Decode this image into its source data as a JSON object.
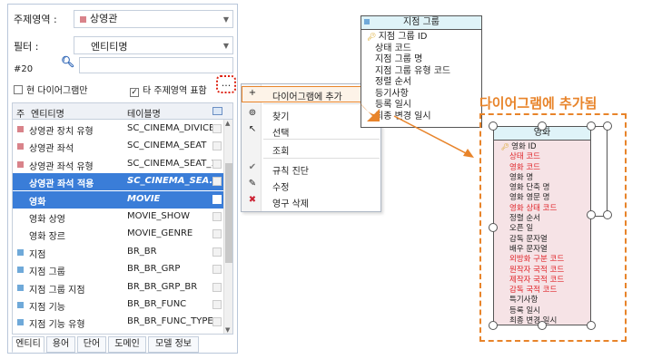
{
  "left_panel": {
    "subject_area": {
      "label": "주제영역 :",
      "value": "상영관",
      "color": "#d9838a"
    },
    "filter": {
      "label": "필터 :",
      "value": "엔티티명"
    },
    "count": "#20",
    "checkbox_current": "현 다이어그램만",
    "checkbox_other": "타 주제영역 표함",
    "dots_button": "...",
    "grid": {
      "headers": [
        "주",
        "엔티티명",
        "테이블명"
      ],
      "rows": [
        {
          "marker": "■",
          "marker_color": "#d9838a",
          "name": "상영관 장치 유형",
          "table": "SC_CINEMA_DIVICE"
        },
        {
          "marker": "■",
          "marker_color": "#d9838a",
          "name": "상영관 좌석",
          "table": "SC_CINEMA_SEAT"
        },
        {
          "marker": "■",
          "marker_color": "#d9838a",
          "name": "상영관 좌석 유형",
          "table": "SC_CINEMA_SEAT_1"
        },
        {
          "marker": "",
          "marker_color": "#d9838a",
          "name": "상영관 좌석 적용",
          "table": "SC_CINEMA_SEA..."
        },
        {
          "marker": "",
          "marker_color": "#d9838a",
          "name": "영화",
          "table": "MOVIE"
        },
        {
          "marker": "",
          "marker_color": "#ffffff",
          "name": "영화 상영",
          "table": "MOVIE_SHOW"
        },
        {
          "marker": "",
          "marker_color": "#ffffff",
          "name": "영화 장르",
          "table": "MOVIE_GENRE"
        },
        {
          "marker": "■",
          "marker_color": "#6fa9d9",
          "name": "지점",
          "table": "BR_BR"
        },
        {
          "marker": "■",
          "marker_color": "#6fa9d9",
          "name": "지점 그룹",
          "table": "BR_BR_GRP"
        },
        {
          "marker": "■",
          "marker_color": "#6fa9d9",
          "name": "지점 그룹 지점",
          "table": "BR_BR_GRP_BR"
        },
        {
          "marker": "■",
          "marker_color": "#6fa9d9",
          "name": "지점 기능",
          "table": "BR_BR_FUNC"
        },
        {
          "marker": "■",
          "marker_color": "#6fa9d9",
          "name": "지점 기능 유형",
          "table": "BR_BR_FUNC_TYPE"
        }
      ]
    },
    "tabs": [
      "엔티티",
      "용어",
      "단어",
      "도메인",
      "모델 정보"
    ]
  },
  "context_menu": {
    "items": [
      {
        "icon": "plus-icon",
        "glyph": "+",
        "label": "다이어그램에 추가"
      },
      {
        "icon": "binoculars-icon",
        "glyph": "⊚",
        "label": "찾기"
      },
      {
        "icon": "cursor-icon",
        "glyph": "↖",
        "label": "선택"
      },
      {
        "icon": "",
        "glyph": "",
        "label": "조회"
      },
      {
        "icon": "check-icon",
        "glyph": "✔",
        "label": "규칙 진단"
      },
      {
        "icon": "edit-icon",
        "glyph": "✎",
        "label": "수정"
      },
      {
        "icon": "delete-icon",
        "glyph": "✖",
        "label": "영구 삭제"
      }
    ]
  },
  "branch_group_entity": {
    "title": "지점 그룹",
    "attributes": [
      "지점 그룹 ID",
      "상태 코드",
      "지점 그룹 명",
      "지점 그룹 유형 코드",
      "정렬 순서",
      "등기사항",
      "등록 일시",
      "최종 변경 일시"
    ]
  },
  "added_label": "다이어그램에 추가됨",
  "movie_entity": {
    "title": "영화",
    "attributes": [
      {
        "text": "영화 ID",
        "red": false
      },
      {
        "text": "상태 코드",
        "red": true
      },
      {
        "text": "영화 코드",
        "red": true
      },
      {
        "text": "영화 명",
        "red": false
      },
      {
        "text": "영화 단축 명",
        "red": false
      },
      {
        "text": "영화 영문 명",
        "red": false
      },
      {
        "text": "영화 상태 코드",
        "red": true
      },
      {
        "text": "정렬 순서",
        "red": false
      },
      {
        "text": "오픈 일",
        "red": false
      },
      {
        "text": "감독 문자열",
        "red": false
      },
      {
        "text": "배우 문자열",
        "red": false
      },
      {
        "text": "외방화 구분 코드",
        "red": true
      },
      {
        "text": "원작자 국적 코드",
        "red": true
      },
      {
        "text": "제작자 국적 코드",
        "red": true
      },
      {
        "text": "감독 국적 코드",
        "red": true
      },
      {
        "text": "특기사항",
        "red": false
      },
      {
        "text": "등록 일시",
        "red": false
      },
      {
        "text": "최종 변경 일시",
        "red": false
      }
    ]
  }
}
